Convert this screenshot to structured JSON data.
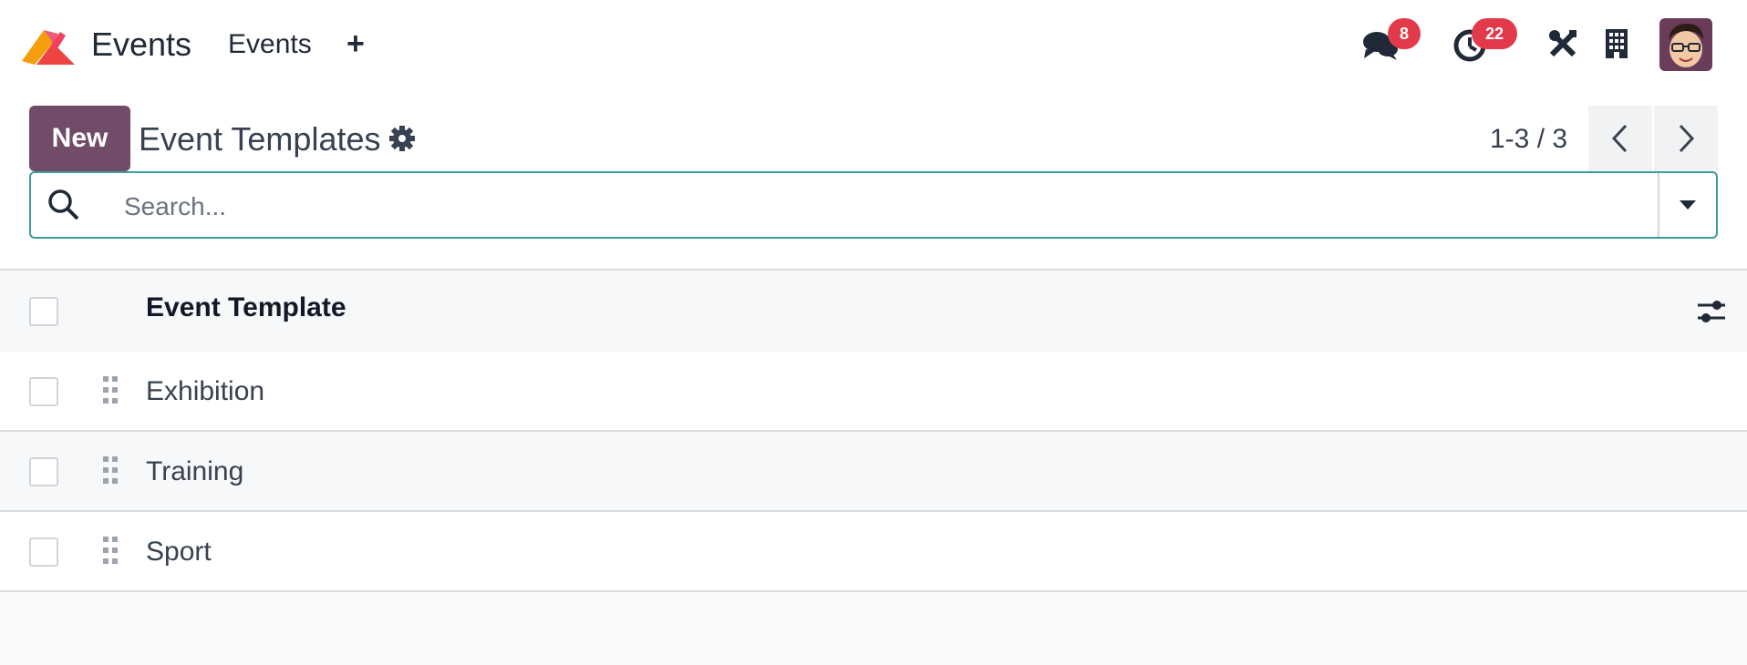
{
  "topbar": {
    "app_title": "Events",
    "menu_item": "Events",
    "plus_label": "+",
    "messages_count": "8",
    "activities_count": "22"
  },
  "control": {
    "new_label": "New",
    "page_title": "Event Templates",
    "pager_value": "1-3 / 3"
  },
  "search": {
    "placeholder": "Search..."
  },
  "table": {
    "header": "Event Template",
    "rows": [
      {
        "name": "Exhibition"
      },
      {
        "name": "Training"
      },
      {
        "name": "Sport"
      }
    ]
  },
  "colors": {
    "brand": "#714b67",
    "badge": "#e23a4b",
    "search_border": "#3b9e9b"
  },
  "icons": [
    "app-logo-icon",
    "plus-icon",
    "messages-icon",
    "activities-clock-icon",
    "tools-icon",
    "building-icon",
    "avatar",
    "gear-icon",
    "chevron-left-icon",
    "chevron-right-icon",
    "search-icon",
    "caret-down-icon",
    "drag-handle-icon",
    "optional-columns-icon"
  ]
}
